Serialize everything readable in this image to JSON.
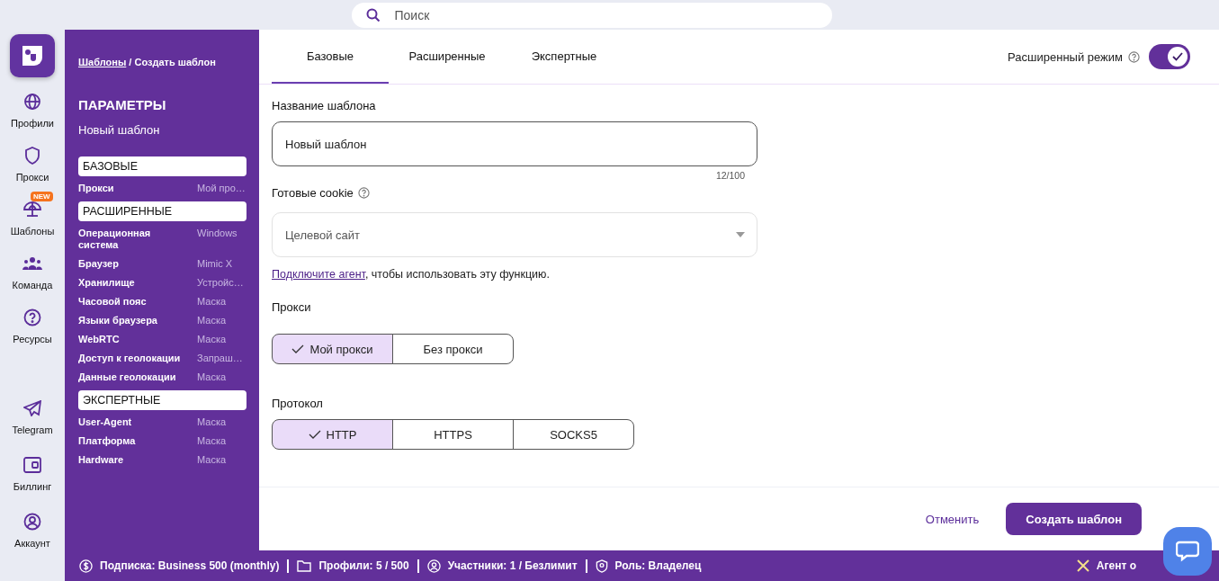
{
  "search": {
    "placeholder": "Поиск"
  },
  "rail": {
    "items": [
      {
        "label": "Профили",
        "selected": false
      },
      {
        "label": "Прокси",
        "selected": false
      },
      {
        "label": "Шаблоны",
        "selected": false,
        "badge": "NEW"
      },
      {
        "label": "Команда",
        "selected": false
      },
      {
        "label": "Ресурсы",
        "selected": false
      }
    ],
    "bottom": [
      {
        "label": "Telegram",
        "selected": false
      },
      {
        "label": "Биллинг",
        "selected": false
      },
      {
        "label": "Аккаунт",
        "selected": false
      }
    ]
  },
  "panel": {
    "breadcrumb_link": "Шаблоны",
    "breadcrumb_rest": "/ Создать шаблон",
    "title": "ПАРАМЕТРЫ",
    "subtitle": "Новый шаблон",
    "sections": [
      {
        "title": "БАЗОВЫЕ",
        "items": [
          {
            "label": "Прокси",
            "value": "Мой про…"
          }
        ]
      },
      {
        "title": "РАСШИРЕННЫЕ",
        "items": [
          {
            "label": "Операционная система",
            "value": "Windows"
          },
          {
            "label": "Браузер",
            "value": "Mimic X"
          },
          {
            "label": "Хранилище",
            "value": "Устройс…"
          },
          {
            "label": "Часовой пояс",
            "value": "Маска"
          },
          {
            "label": "Языки браузера",
            "value": "Маска"
          },
          {
            "label": "WebRTC",
            "value": "Маска"
          },
          {
            "label": "Доступ к геолокации",
            "value": "Запраш…"
          },
          {
            "label": "Данные геолокации",
            "value": "Маска"
          }
        ]
      },
      {
        "title": "ЭКСПЕРТНЫЕ",
        "items": [
          {
            "label": "User-Agent",
            "value": "Маска"
          },
          {
            "label": "Платформа",
            "value": "Маска"
          },
          {
            "label": "Hardware",
            "value": "Маска"
          }
        ]
      }
    ]
  },
  "tabs": [
    {
      "label": "Базовые",
      "selected": true
    },
    {
      "label": "Расширенные",
      "selected": false
    },
    {
      "label": "Экспертные",
      "selected": false
    }
  ],
  "advanced_mode": {
    "label": "Расширенный режим",
    "on": true
  },
  "form": {
    "name_label": "Название шаблона",
    "name_value": "Новый шаблон",
    "counter": "12/100",
    "cookie_label": "Готовые cookie",
    "cookie_placeholder": "Целевой сайт",
    "agent_link": "Подключите агент",
    "agent_text": ", чтобы использовать эту функцию.",
    "proxy_label": "Прокси",
    "proxy_options": [
      {
        "label": "Мой прокси",
        "selected": true
      },
      {
        "label": "Без прокси",
        "selected": false
      }
    ],
    "protocol_label": "Протокол",
    "protocol_options": [
      {
        "label": "HTTP",
        "selected": true
      },
      {
        "label": "HTTPS",
        "selected": false
      },
      {
        "label": "SOCKS5",
        "selected": false
      }
    ]
  },
  "buttons": {
    "cancel": "Отменить",
    "create": "Создать шаблон"
  },
  "status_bar": {
    "items": [
      {
        "text": "Подписка: Business 500 (monthly)"
      },
      {
        "text": "Профили: 5 / 500"
      },
      {
        "text": "Участники: 1 / Безлимит"
      },
      {
        "text": "Роль: Владелец"
      }
    ],
    "agent": "Агент о"
  }
}
